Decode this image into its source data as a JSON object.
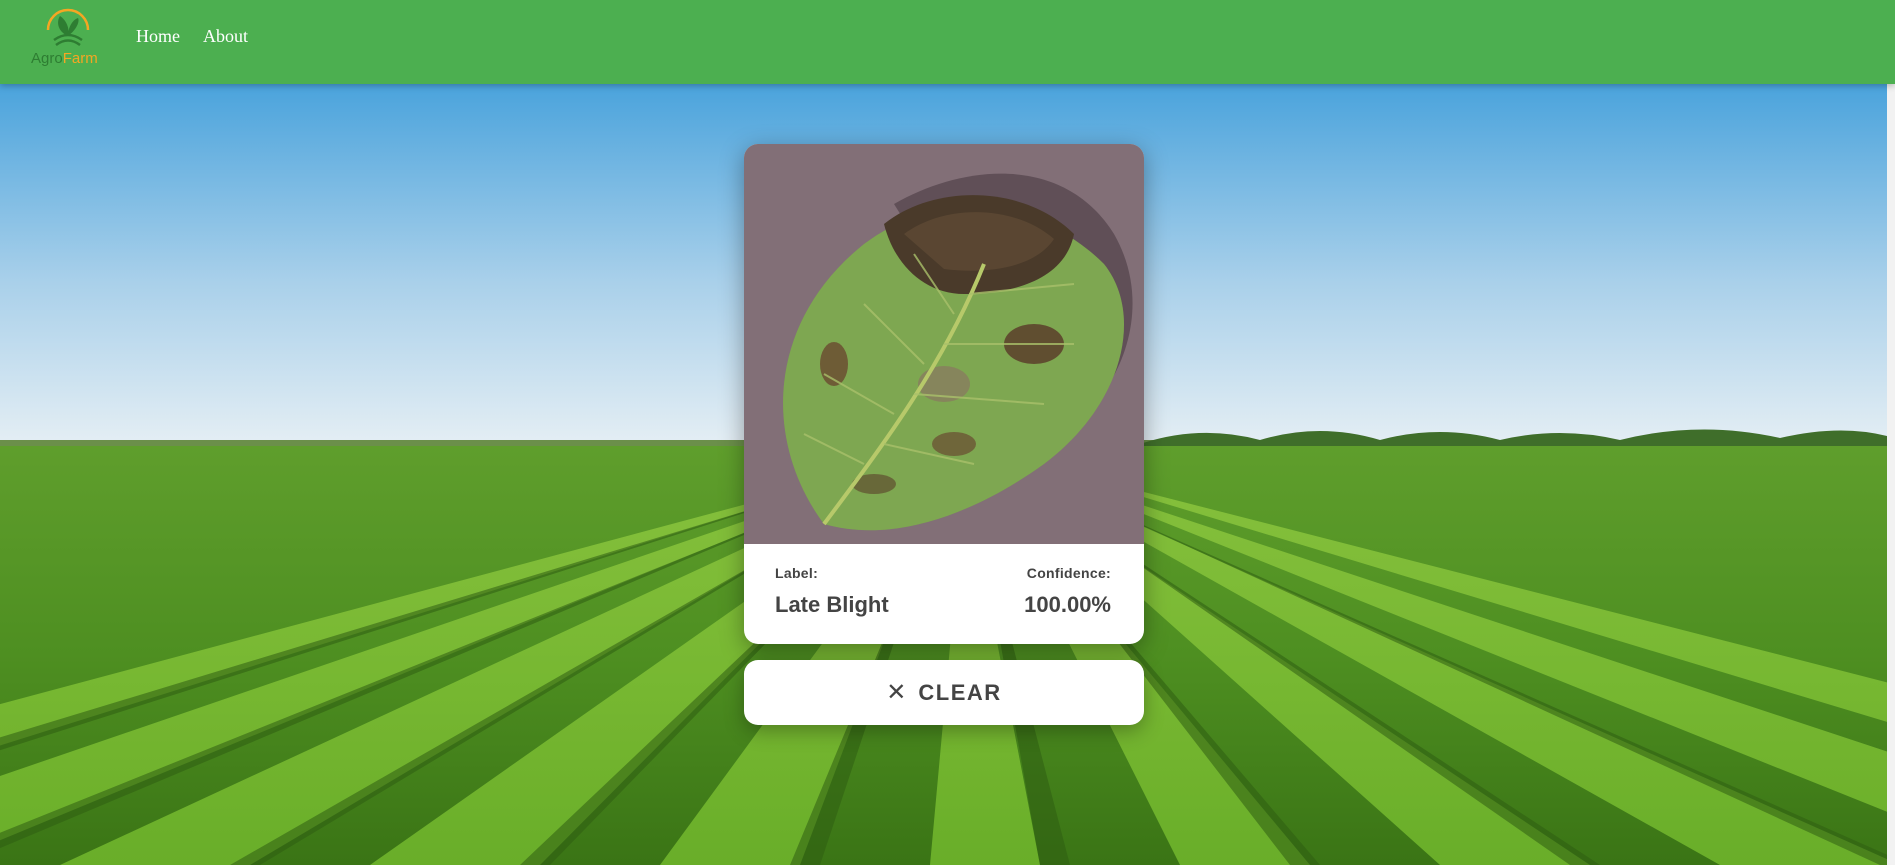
{
  "brand": {
    "part1": "Agro",
    "part2": "Farm"
  },
  "nav": {
    "home": "Home",
    "about": "About"
  },
  "result": {
    "label_caption": "Label:",
    "label_value": "Late Blight",
    "confidence_caption": "Confidence:",
    "confidence_value": "100.00%"
  },
  "clear_button": {
    "icon": "close-icon",
    "label": "CLEAR"
  },
  "colors": {
    "navbar": "#4caf50",
    "brand_dark": "#2e7d32",
    "brand_orange": "#f5a623",
    "text": "#444444"
  },
  "images": {
    "background": "green soybean field under blue sky",
    "preview": "potato leaf with late blight lesions"
  }
}
